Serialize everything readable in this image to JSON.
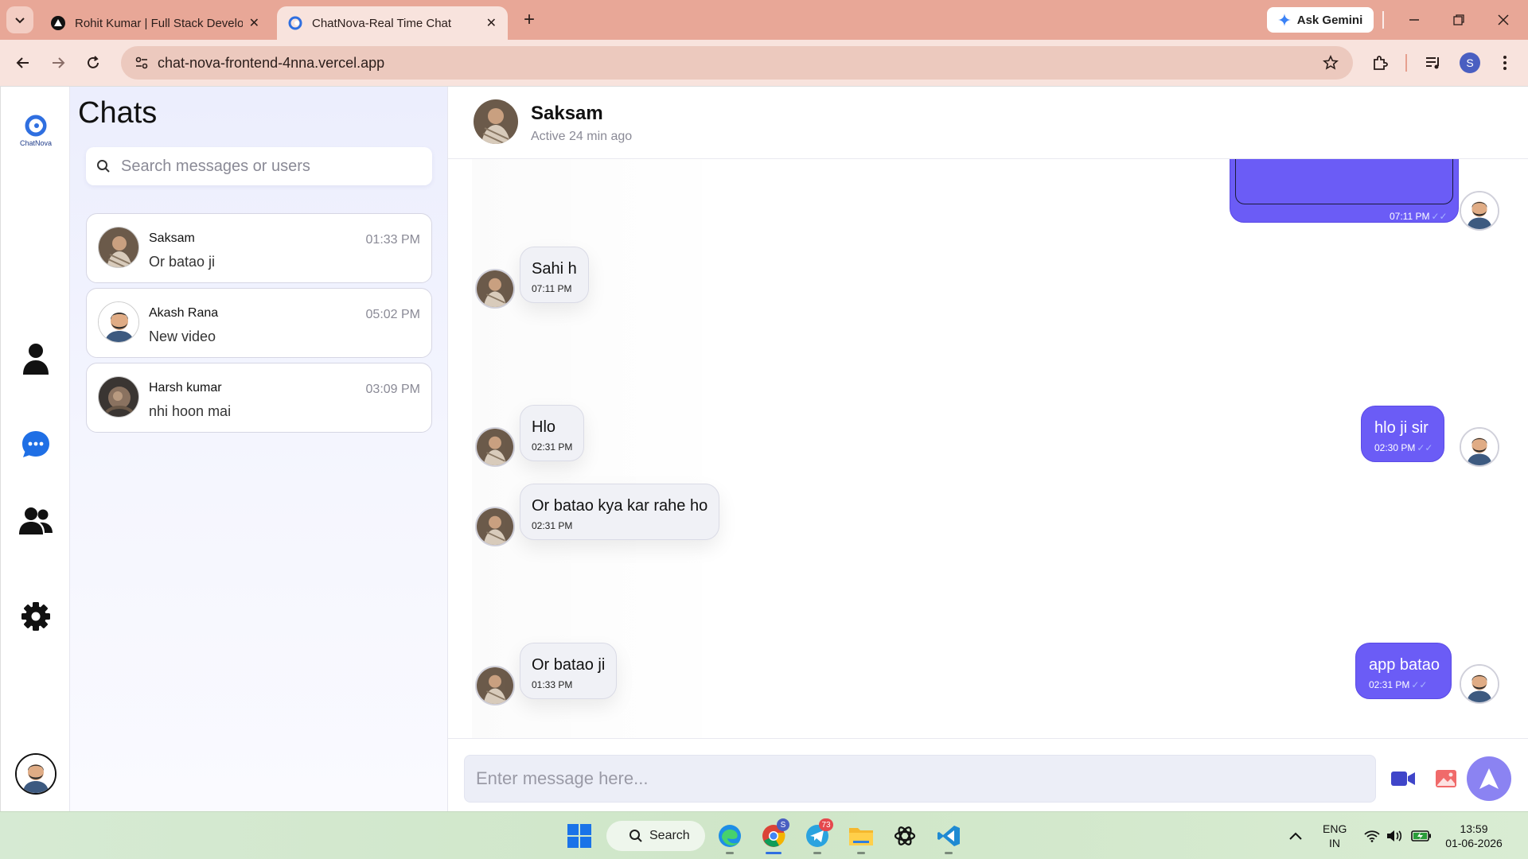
{
  "browser": {
    "tabs": [
      {
        "title": "Rohit Kumar | Full Stack Develo"
      },
      {
        "title": "ChatNova-Real Time Chat"
      }
    ],
    "ask_gemini": "Ask Gemini",
    "url": "chat-nova-frontend-4nna.vercel.app",
    "profile_initial": "S"
  },
  "app": {
    "logo_text": "ChatNova",
    "chats_title": "Chats",
    "search_placeholder": "Search messages or users",
    "conversations": [
      {
        "name": "Saksam",
        "last_message": "Or batao ji",
        "time": "01:33 PM"
      },
      {
        "name": "Akash Rana",
        "last_message": "New video",
        "time": "05:02 PM"
      },
      {
        "name": "Harsh kumar",
        "last_message": "nhi hoon mai",
        "time": "03:09 PM"
      }
    ],
    "header": {
      "name": "Saksam",
      "status": "Active 24 min ago"
    },
    "messages": [
      {
        "direction": "out",
        "text": "",
        "time": "07:11 PM"
      },
      {
        "direction": "in",
        "text": "Sahi h",
        "time": "07:11 PM"
      },
      {
        "direction": "out",
        "text": "hlo ji sir",
        "time": "02:30 PM"
      },
      {
        "direction": "in",
        "text": "Hlo",
        "time": "02:31 PM"
      },
      {
        "direction": "in",
        "text": "Or batao kya kar rahe ho",
        "time": "02:31 PM"
      },
      {
        "direction": "out",
        "text": "app batao",
        "time": "02:31 PM"
      },
      {
        "direction": "in",
        "text": "Or batao ji",
        "time": "01:33 PM"
      }
    ],
    "message_placeholder": "Enter message here...",
    "colors": {
      "accent": "#6b5cf6",
      "send": "#8b83f2",
      "rail_icon": "#1f6fe5"
    }
  },
  "taskbar": {
    "search_label": "Search",
    "chrome_badge": "S",
    "telegram_badge": "73",
    "language": "ENG",
    "region": "IN",
    "time": "13:59",
    "date": "01-06-2026"
  }
}
